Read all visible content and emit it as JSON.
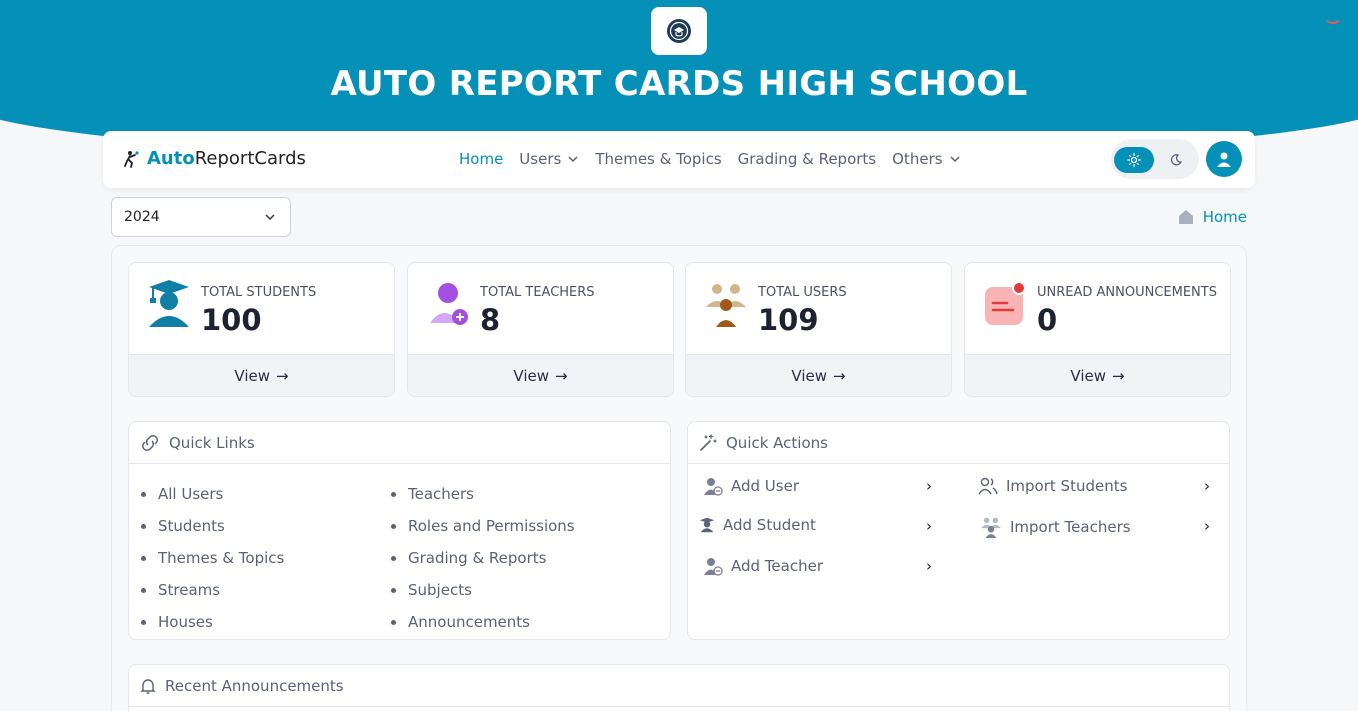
{
  "school": {
    "title": "AUTO REPORT CARDS HIGH SCHOOL"
  },
  "brand": {
    "part1": "Auto",
    "part2": "ReportCards"
  },
  "nav": {
    "items": [
      {
        "label": "Home",
        "active": true,
        "dropdown": false
      },
      {
        "label": "Users",
        "active": false,
        "dropdown": true
      },
      {
        "label": "Themes & Topics",
        "active": false,
        "dropdown": false
      },
      {
        "label": "Grading & Reports",
        "active": false,
        "dropdown": false
      },
      {
        "label": "Others",
        "active": false,
        "dropdown": true
      }
    ]
  },
  "year_select": {
    "value": "2024"
  },
  "breadcrumb": {
    "label": "Home"
  },
  "stats": [
    {
      "label": "TOTAL STUDENTS",
      "value": "100",
      "action": "View"
    },
    {
      "label": "TOTAL TEACHERS",
      "value": "8",
      "action": "View"
    },
    {
      "label": "TOTAL USERS",
      "value": "109",
      "action": "View"
    },
    {
      "label": "UNREAD ANNOUNCEMENTS",
      "value": "0",
      "action": "View"
    }
  ],
  "quick_links": {
    "title": "Quick Links",
    "col1": [
      "All Users",
      "Students",
      "Themes & Topics",
      "Streams",
      "Houses"
    ],
    "col2": [
      "Teachers",
      "Roles and Permissions",
      "Grading & Reports",
      "Subjects",
      "Announcements"
    ]
  },
  "quick_actions": {
    "title": "Quick Actions",
    "items": [
      "Add User",
      "Add Student",
      "Add Teacher",
      "Import Students",
      "Import Teachers"
    ]
  },
  "recent": {
    "title": "Recent Announcements"
  },
  "colors": {
    "primary": "#0590b8",
    "background": "#f6f7f9"
  }
}
